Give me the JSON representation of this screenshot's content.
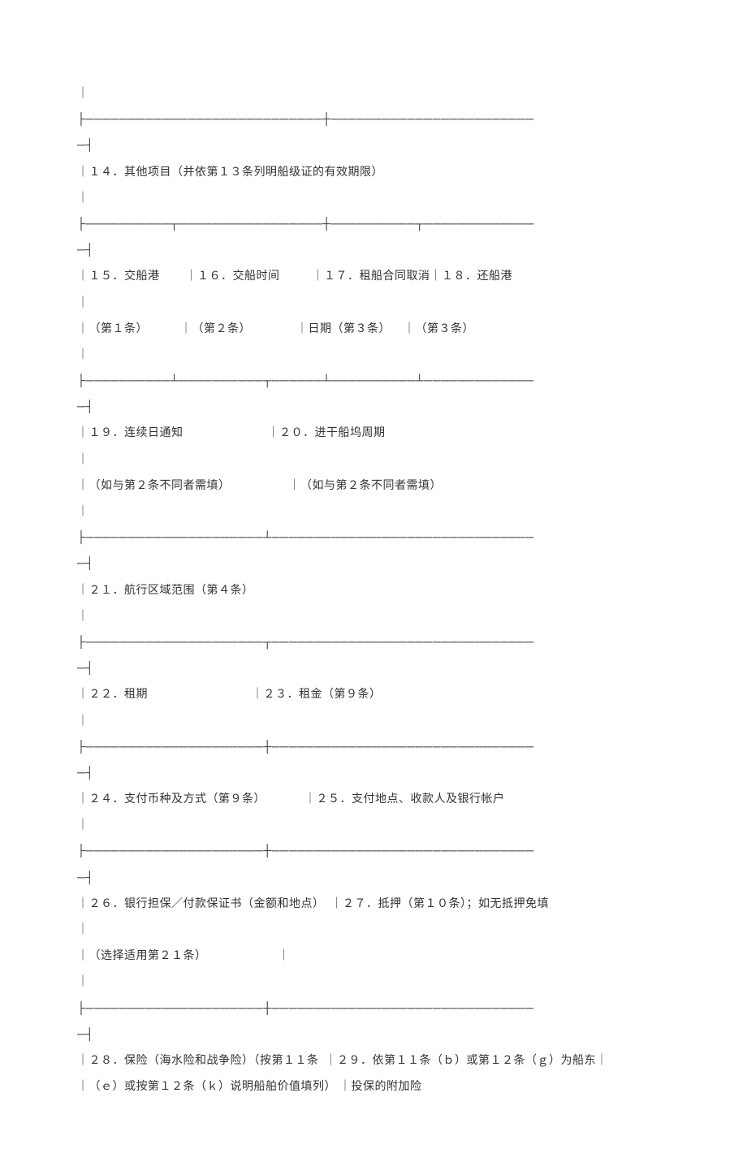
{
  "lines": [
    "｜",
    "├────────────────────────────┼────────────────────────",
    "─┤",
    "｜１４．其他项目（并依第１３条列明船级证的有效期限）",
    "｜",
    "├──────────┬─────────────────┼──────────┬─────────────",
    "─┤",
    "｜１５．交船港        ｜１６．交船时间          ｜１７．租船合同取消｜１８．还船港",
    "｜",
    "｜（第１条）          ｜（第２条）              ｜日期（第３条）    ｜（第３条）",
    "｜",
    "├──────────┴──────────┬──────┴──────────┴─────────────",
    "─┤",
    "｜１９．连续日通知                          ｜２０．进干船坞周期",
    "｜",
    "｜（如与第２条不同者需填）                  ｜（如与第２条不同者需填）",
    "｜",
    "├─────────────────────┴───────────────────────────────",
    "─┤",
    "｜２１．航行区域范围（第４条）",
    "｜",
    "├─────────────────────┬───────────────────────────────",
    "─┤",
    "｜２２．租期                                ｜２３．租金（第９条）",
    "｜",
    "├─────────────────────┼───────────────────────────────",
    "─┤",
    "｜２４．支付币种及方式（第９条）            ｜２５．支付地点、收款人及银行帐户",
    "｜",
    "├─────────────────────┼───────────────────────────────",
    "─┤",
    "｜２６．银行担保／付款保证书（金额和地点）  ｜２７．抵押（第１０条）；如无抵押免填",
    "｜",
    "｜（选择适用第２１条）                      ｜",
    "｜",
    "├─────────────────────┼───────────────────────────────",
    "─┤",
    "｜２８．保险（海水险和战争险）（按第１１条  ｜２９．依第１１条（ｂ）或第１２条（ｇ）为船东｜",
    "｜（ｅ）或按第１２条（ｋ）说明船舶价值填列） ｜投保的附加险"
  ]
}
